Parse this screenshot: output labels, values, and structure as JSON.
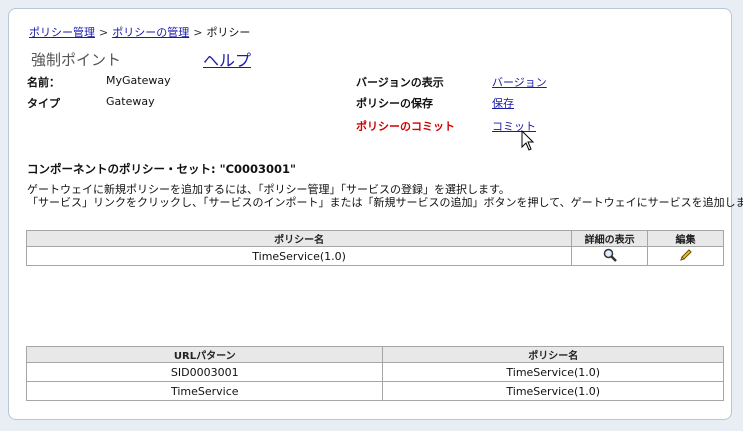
{
  "breadcrumb": {
    "items": [
      "ポリシー管理",
      "ポリシーの管理",
      "ポリシー"
    ],
    "separator": ">"
  },
  "header": {
    "title": "強制ポイント",
    "help_label": "ヘルプ"
  },
  "info": {
    "name_label": "名前：",
    "name_value": "MyGateway",
    "type_label": "タイプ",
    "type_value": "Gateway"
  },
  "actions": {
    "version_label": "バージョンの表示",
    "version_link": "バージョン",
    "save_label": "ポリシーの保存",
    "save_link": "保存",
    "commit_label": "ポリシーのコミット",
    "commit_link": "コミット"
  },
  "section": {
    "title": "コンポーネントのポリシー・セット: \"C0003001\"",
    "description_line1": "ゲートウェイに新規ポリシーを追加するには、「ポリシー管理」「サービスの登録」を選択します。",
    "description_line2": "「サービス」リンクをクリックし、「サービスのインポート」または「新規サービスの追加」ボタンを押して、ゲートウェイにサービスを追加します。"
  },
  "policy_table": {
    "headers": [
      "ポリシー名",
      "詳細の表示",
      "編集"
    ],
    "rows": [
      {
        "name": "TimeService(1.0)",
        "view_icon": "magnifier-icon",
        "edit_icon": "pencil-icon"
      }
    ]
  },
  "url_table": {
    "headers": [
      "URLパターン",
      "ポリシー名"
    ],
    "rows": [
      {
        "pattern": "SID0003001",
        "policy": "TimeService(1.0)"
      },
      {
        "pattern": "TimeService",
        "policy": "TimeService(1.0)"
      }
    ]
  },
  "colors": {
    "link": "#1a1aaa",
    "commit_label": "#d00000",
    "header_bg": "#e8e8e8",
    "border": "#a6a6a6"
  }
}
